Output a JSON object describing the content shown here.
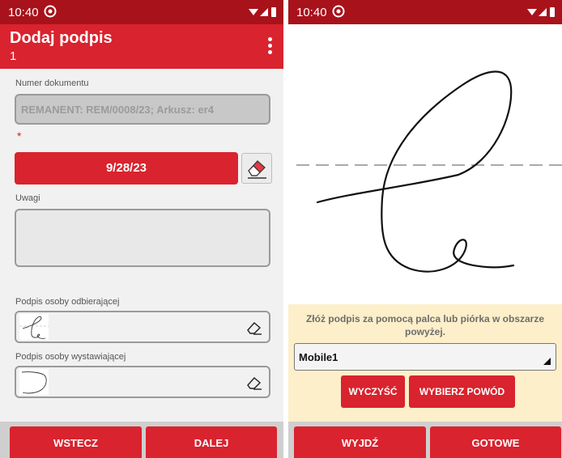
{
  "colors": {
    "primary": "#d9232e",
    "status_bar": "#a8121b",
    "panel_bg": "#fcefc9"
  },
  "left": {
    "status": {
      "time": "10:40"
    },
    "header": {
      "title": "Dodaj podpis",
      "subtitle": "1"
    },
    "doc_number": {
      "label": "Numer dokumentu",
      "value": "REMANENT: REM/0008/23; Arkusz: er4"
    },
    "required_marker": "*",
    "date_button": "9/28/23",
    "notes": {
      "label": "Uwagi",
      "value": ""
    },
    "receiver_signature": {
      "label": "Podpis osoby odbierającej"
    },
    "issuer_signature": {
      "label": "Podpis osoby wystawiającej"
    },
    "footer": {
      "back_label": "WSTECZ",
      "next_label": "DALEJ"
    }
  },
  "right": {
    "status": {
      "time": "10:40"
    },
    "instruction": "Złóż podpis za pomocą palca lub piórka w obszarze powyżej.",
    "device_select": {
      "value": "Mobile1"
    },
    "clear_label": "WYCZYŚĆ",
    "reason_label": "WYBIERZ POWÓD",
    "footer": {
      "exit_label": "WYJDŹ",
      "done_label": "GOTOWE"
    }
  }
}
